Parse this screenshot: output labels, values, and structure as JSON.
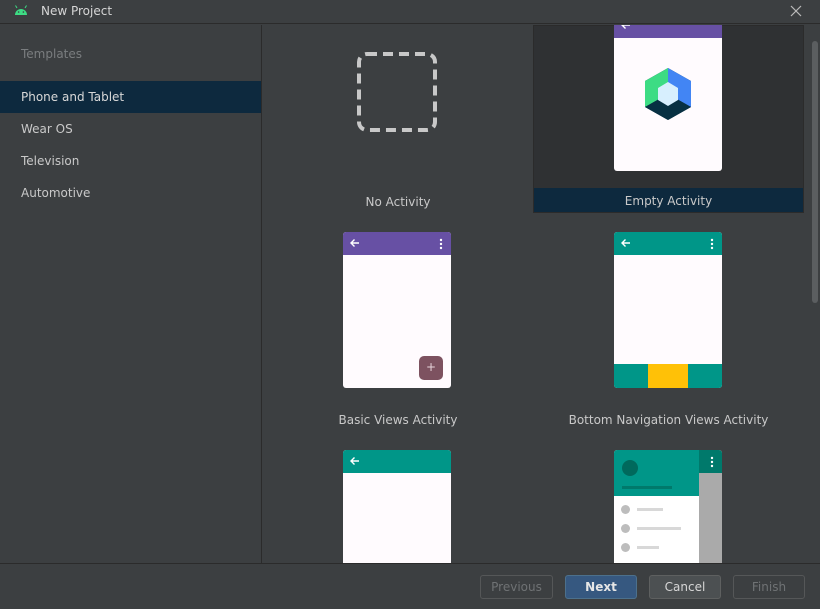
{
  "window": {
    "title": "New Project",
    "icon": "android-icon",
    "accent_color": "#3ddc84"
  },
  "sidebar": {
    "section_label": "Templates",
    "items": [
      {
        "label": "Phone and Tablet",
        "selected": true
      },
      {
        "label": "Wear OS",
        "selected": false
      },
      {
        "label": "Television",
        "selected": false
      },
      {
        "label": "Automotive",
        "selected": false
      }
    ]
  },
  "templates": [
    {
      "label": "No Activity",
      "selected": false
    },
    {
      "label": "Empty Activity",
      "selected": true
    },
    {
      "label": "Basic Views Activity",
      "selected": false
    },
    {
      "label": "Bottom Navigation Views Activity",
      "selected": false
    },
    {
      "label": "",
      "selected": false
    },
    {
      "label": "",
      "selected": false
    }
  ],
  "colors": {
    "purple_appbar": "#6750a4",
    "teal_appbar": "#009688",
    "fab": "#7d5260",
    "nav_highlight": "#ffc107",
    "selection": "#0d293e",
    "primary_button": "#365880"
  },
  "footer": {
    "previous_label": "Previous",
    "next_label": "Next",
    "cancel_label": "Cancel",
    "finish_label": "Finish"
  }
}
